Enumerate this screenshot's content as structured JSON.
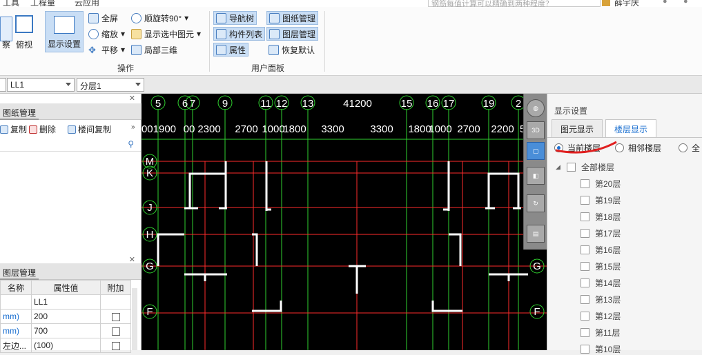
{
  "menu": [
    "工具",
    "工程量",
    "云应用"
  ],
  "search": {
    "placeholder": "钢筋每值计算可以精确到两种程度？"
  },
  "user": {
    "name": "薛宇庆"
  },
  "ribbon": {
    "view_left": "察",
    "view_top": "俯视",
    "display_settings": "显示设置",
    "fullscreen": "全屏",
    "zoom": "缩放",
    "pan": "平移",
    "rotate": "顺旋转90°",
    "show_selected": "显示选中图元",
    "local_3d": "局部三维",
    "group_ops": "操作",
    "nav_tree": "导航树",
    "drawing_mgmt": "图纸管理",
    "component_list": "构件列表",
    "layer_mgmt": "图层管理",
    "properties": "属性",
    "restore_default": "恢复默认",
    "group_user": "用户面板"
  },
  "selectors": {
    "component": "LL1",
    "floor": "分层1"
  },
  "drawing_panel": {
    "title": "图纸管理",
    "copy": "复制",
    "delete": "删除",
    "copy_between": "楼间复制"
  },
  "layer_panel": {
    "title": "图层管理",
    "col_name": "名称",
    "col_value": "属性值",
    "col_extra": "附加",
    "rows": [
      {
        "name": "",
        "value": "LL1"
      },
      {
        "name": "mm)",
        "value": "200"
      },
      {
        "name": "mm)",
        "value": "700"
      },
      {
        "name": "左边...",
        "value": "(100)"
      }
    ]
  },
  "cad": {
    "axis_numbers": [
      "5",
      "6",
      "7",
      "9",
      "11",
      "12",
      "13",
      "15",
      "16",
      "17",
      "19",
      "2"
    ],
    "dims": [
      "001900",
      "00",
      "2300",
      "2700",
      "1000",
      "1800",
      "3300",
      "3300",
      "1800",
      "1000",
      "2700",
      "2200",
      "5"
    ],
    "total": "41200",
    "row_labels": [
      "M",
      "K",
      "J",
      "H",
      "G",
      "F"
    ],
    "right_labels": [
      "G",
      "F"
    ]
  },
  "display_panel": {
    "title": "显示设置",
    "tab_elements": "图元显示",
    "tab_floors": "楼层显示",
    "radio_current": "当前楼层",
    "radio_adjacent": "相邻楼层",
    "radio_all": "全",
    "all_floors": "全部楼层",
    "floors": [
      "第20层",
      "第19层",
      "第18层",
      "第17层",
      "第16层",
      "第15层",
      "第14层",
      "第13层",
      "第12层",
      "第11层",
      "第10层"
    ]
  },
  "vtool": {
    "btn_3d": "3D"
  },
  "colors": {
    "accent": "#1a6fd0",
    "cad_bg": "#000000",
    "axis_green": "#2fd22f",
    "grid_red": "#ff2b2b",
    "wall": "#ffffff"
  }
}
